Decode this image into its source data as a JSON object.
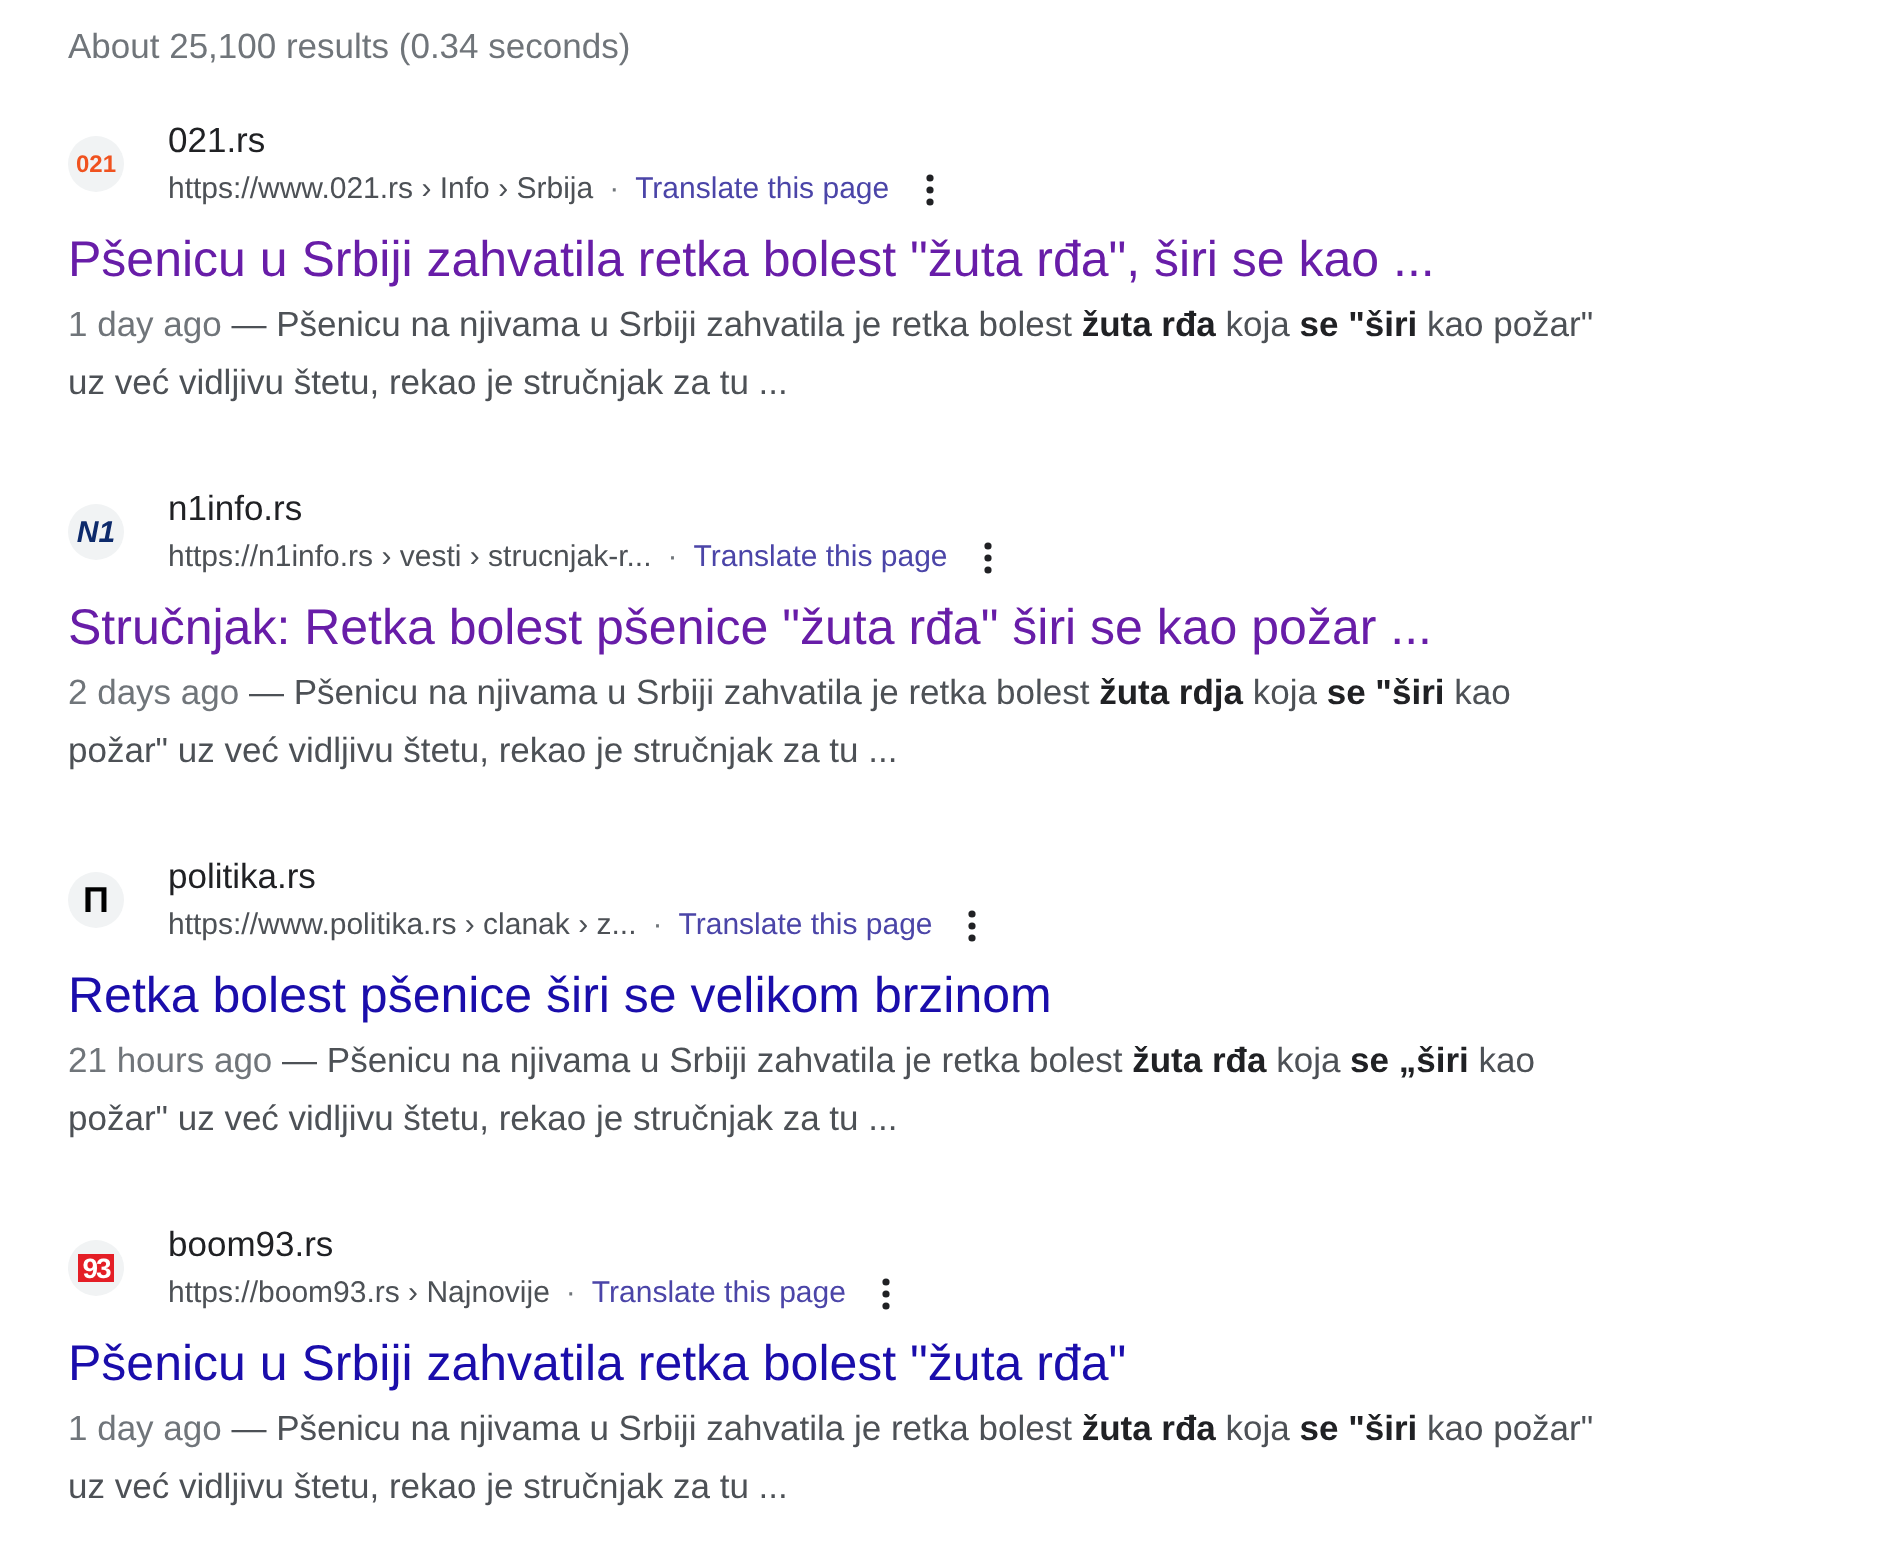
{
  "result_stats": "About 25,100 results (0.34 seconds)",
  "results": [
    {
      "favicon": {
        "text": "021",
        "kind": "orange"
      },
      "site": "021.rs",
      "url": "https://www.021.rs › Info › Srbija",
      "separator": "·",
      "translate": "Translate this page",
      "title": "Pšenicu u Srbiji zahvatila retka bolest \"žuta rđa\", širi se kao ...",
      "visited": true,
      "date": "1 day ago",
      "snippet": "— Pšenicu na njivama u Srbiji zahvatila je retka bolest **žuta rđa** koja **se \"širi** kao požar\" uz već vidljivu štetu, rekao je stručnjak za tu ..."
    },
    {
      "favicon": {
        "text": "N1",
        "kind": "navy"
      },
      "site": "n1info.rs",
      "url": "https://n1info.rs › vesti › strucnjak-r...",
      "separator": "·",
      "translate": "Translate this page",
      "title": "Stručnjak: Retka bolest pšenice \"žuta rđa\" širi se kao požar ...",
      "visited": true,
      "date": "2 days ago",
      "snippet": "— Pšenicu na njivama u Srbiji zahvatila je retka bolest **žuta rdja** koja **se \"širi** kao požar\" uz već vidljivu štetu, rekao je stručnjak za tu ..."
    },
    {
      "favicon": {
        "text": "П",
        "kind": "black"
      },
      "site": "politika.rs",
      "url": "https://www.politika.rs › clanak › z...",
      "separator": "·",
      "translate": "Translate this page",
      "title": "Retka bolest pšenice širi se velikom brzinom",
      "visited": false,
      "date": "21 hours ago",
      "snippet": "— Pšenicu na njivama u Srbiji zahvatila je retka bolest **žuta rđa** koja **se „širi** kao požar\" uz već vidljivu štetu, rekao je stručnjak za tu ..."
    },
    {
      "favicon": {
        "text": "93",
        "kind": "red_box"
      },
      "site": "boom93.rs",
      "url": "https://boom93.rs › Najnovije",
      "separator": "·",
      "translate": "Translate this page",
      "title": "Pšenicu u Srbiji zahvatila retka bolest \"žuta rđa\"",
      "visited": false,
      "date": "1 day ago",
      "snippet": "— Pšenicu na njivama u Srbiji zahvatila je retka bolest **žuta rđa** koja **se \"širi** kao požar\" uz već vidljivu štetu, rekao je stručnjak za tu ..."
    }
  ]
}
